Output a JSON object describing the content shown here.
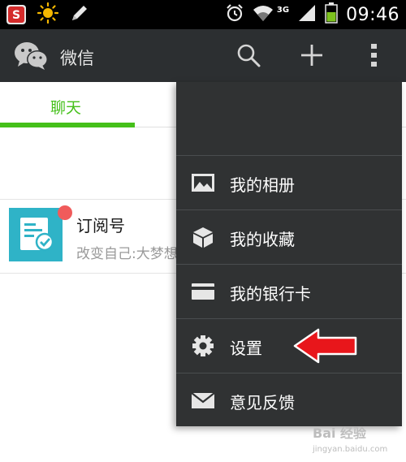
{
  "status_bar": {
    "time": "09:46",
    "network": "3G",
    "icons": [
      "app-s-icon",
      "sun-icon",
      "pencil-icon",
      "alarm-icon",
      "wifi-icon",
      "signal-icon",
      "battery-icon"
    ]
  },
  "header": {
    "title": "微信",
    "icons": [
      "wechat-logo-icon",
      "search-icon",
      "plus-icon",
      "more-vertical-icon"
    ]
  },
  "tabs": [
    {
      "label": "聊天",
      "active": true
    }
  ],
  "chat_list": [
    {
      "title": "订阅号",
      "preview": "改变自己:大梦想",
      "badge": true,
      "avatar_icon": "subscription-icon"
    }
  ],
  "menu": {
    "items": [
      {
        "label": "我的相册",
        "icon": "photo-album-icon"
      },
      {
        "label": "我的收藏",
        "icon": "favorites-cube-icon"
      },
      {
        "label": "我的银行卡",
        "icon": "bank-card-icon"
      },
      {
        "label": "设置",
        "icon": "settings-gear-icon"
      },
      {
        "label": "意见反馈",
        "icon": "feedback-envelope-icon"
      }
    ]
  },
  "annotation": {
    "icon": "red-arrow-icon",
    "color": "#e8161b"
  },
  "watermark": {
    "main": "Bai 经验",
    "sub": "jingyan.baidu.com"
  },
  "colors": {
    "accent": "#45c01a",
    "titlebar": "#2c2f31",
    "menu": "#303233",
    "avatar": "#2fb3c7",
    "badge": "#f05b5b"
  }
}
